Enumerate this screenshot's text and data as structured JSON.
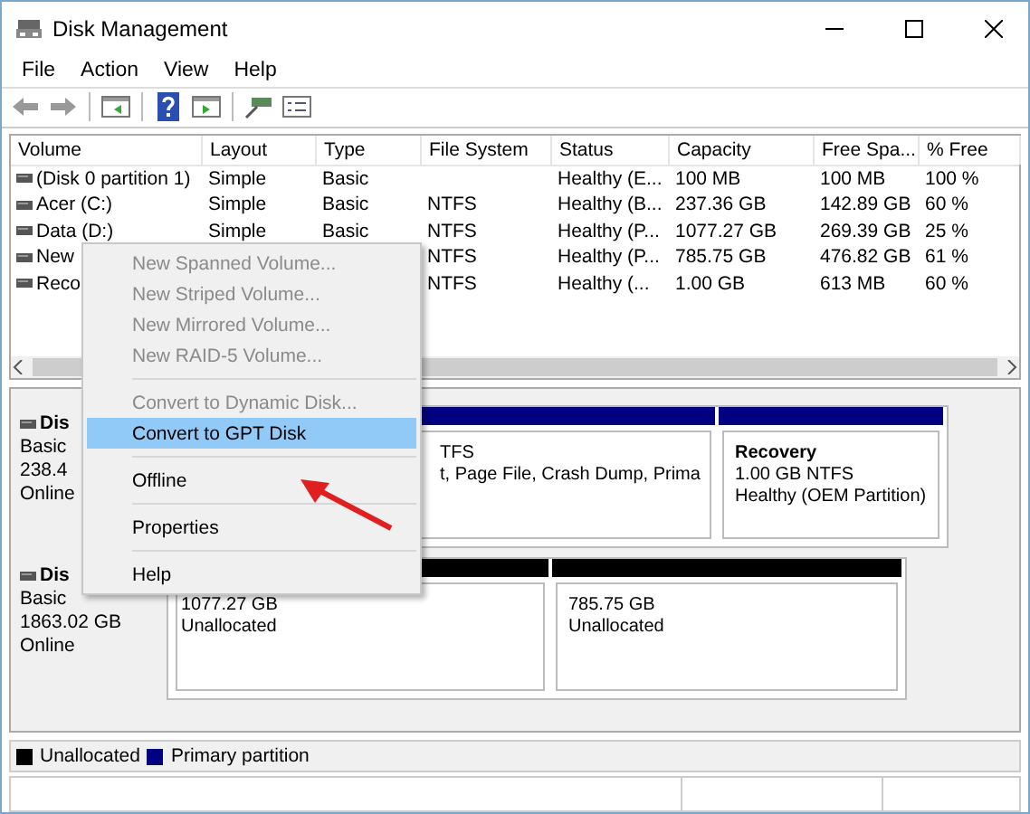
{
  "window": {
    "title": "Disk Management"
  },
  "menu_bar": [
    {
      "label": "File"
    },
    {
      "label": "Action"
    },
    {
      "label": "View"
    },
    {
      "label": "Help"
    }
  ],
  "table": {
    "columns": [
      {
        "label": "Volume"
      },
      {
        "label": "Layout"
      },
      {
        "label": "Type"
      },
      {
        "label": "File System"
      },
      {
        "label": "Status"
      },
      {
        "label": "Capacity"
      },
      {
        "label": "Free Spa..."
      },
      {
        "label": "% Free"
      }
    ],
    "rows": [
      {
        "volume": "(Disk 0 partition 1)",
        "layout": "Simple",
        "type": "Basic",
        "status": "Healthy (E...",
        "capacity": "100 MB",
        "free_space": "100 MB",
        "percent_free": "100 %"
      },
      {
        "volume": "Acer (C:)",
        "layout": "Simple",
        "type": "Basic",
        "file_system": "NTFS",
        "status": "Healthy (B...",
        "capacity": "237.36 GB",
        "free_space": "142.89 GB",
        "percent_free": "60 %"
      },
      {
        "volume": "Data (D:)",
        "layout": "Simple",
        "type": "Basic",
        "file_system": "NTFS",
        "status": "Healthy (P...",
        "capacity": "1077.27 GB",
        "free_space": "269.39 GB",
        "percent_free": "25 %"
      },
      {
        "volume": "New",
        "file_system": "NTFS",
        "status": "Healthy (P...",
        "capacity": "785.75 GB",
        "free_space": "476.82 GB",
        "percent_free": "61 %"
      },
      {
        "volume": "Reco",
        "file_system": "NTFS",
        "status": "Healthy (...",
        "capacity": "1.00 GB",
        "free_space": "613 MB",
        "percent_free": "60 %"
      }
    ]
  },
  "disks": [
    {
      "name": "Dis",
      "lines": [
        "Basic",
        "238.4",
        "Online"
      ],
      "partitions": [
        {
          "kind": "primary",
          "lines": [
            "TFS",
            "t, Page File, Crash Dump, Prima"
          ]
        },
        {
          "kind": "primary",
          "title": "Recovery",
          "lines": [
            "1.00 GB NTFS",
            "Healthy (OEM Partition)"
          ]
        }
      ]
    },
    {
      "name": "Dis",
      "lines": [
        "Basic",
        "1863.02 GB",
        "Online"
      ],
      "partitions": [
        {
          "kind": "unallocated",
          "lines": [
            "1077.27 GB",
            "Unallocated"
          ]
        },
        {
          "kind": "unallocated",
          "lines": [
            "785.75 GB",
            "Unallocated"
          ]
        }
      ]
    }
  ],
  "legend": [
    {
      "label": "Unallocated",
      "color": "#000000"
    },
    {
      "label": "Primary partition",
      "color": "#000080"
    }
  ],
  "context_menu": [
    {
      "kind": "item",
      "label": "New Spanned Volume...",
      "disabled": true,
      "selected": false
    },
    {
      "kind": "item",
      "label": "New Striped Volume...",
      "disabled": true,
      "selected": false
    },
    {
      "kind": "item",
      "label": "New Mirrored Volume...",
      "disabled": true,
      "selected": false
    },
    {
      "kind": "item",
      "label": "New RAID-5 Volume...",
      "disabled": true,
      "selected": false
    },
    {
      "kind": "separator"
    },
    {
      "kind": "item",
      "label": "Convert to Dynamic Disk...",
      "disabled": true,
      "selected": false
    },
    {
      "kind": "item",
      "label": "Convert to GPT Disk",
      "disabled": false,
      "selected": true
    },
    {
      "kind": "separator"
    },
    {
      "kind": "item",
      "label": "Offline",
      "disabled": false,
      "selected": false
    },
    {
      "kind": "separator"
    },
    {
      "kind": "item",
      "label": "Properties",
      "disabled": false,
      "selected": false
    },
    {
      "kind": "separator"
    },
    {
      "kind": "item",
      "label": "Help",
      "disabled": false,
      "selected": false
    }
  ]
}
